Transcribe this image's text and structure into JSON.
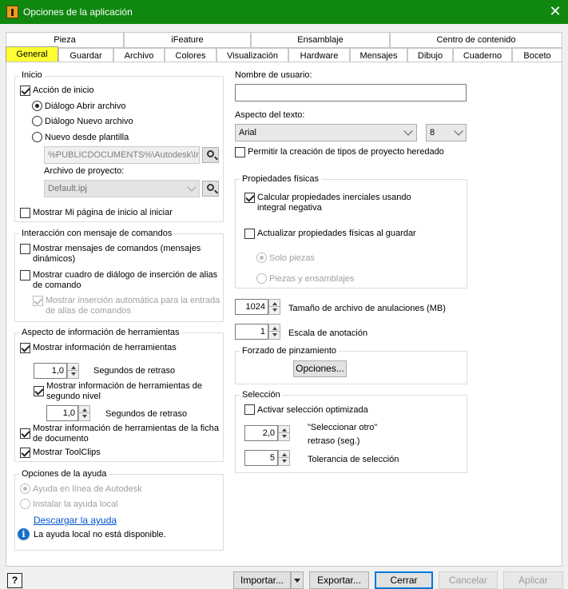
{
  "window": {
    "title": "Opciones de la aplicación"
  },
  "tabs_row1": [
    "Pieza",
    "iFeature",
    "Ensamblaje",
    "Centro de contenido"
  ],
  "tabs_row2": [
    "General",
    "Guardar",
    "Archivo",
    "Colores",
    "Visualización",
    "Hardware",
    "Mensajes",
    "Dibujo",
    "Cuaderno",
    "Boceto"
  ],
  "inicio": {
    "title": "Inicio",
    "accion_inicio": "Acción de inicio",
    "abrir": "Diálogo Abrir archivo",
    "nuevo": "Diálogo Nuevo archivo",
    "plantilla": "Nuevo desde plantilla",
    "plantilla_path": "%PUBLICDOCUMENTS%\\Autodesk\\Inve",
    "proyecto_label": "Archivo de proyecto:",
    "proyecto_value": "Default.ipj",
    "mostrar_pagina": "Mostrar Mi página de inicio al iniciar"
  },
  "interaccion": {
    "title": "Interacción con mensaje de comandos",
    "mensajes": "Mostrar mensajes de comandos (mensajes dinámicos)",
    "alias": "Mostrar cuadro de diálogo de inserción de alias de comando",
    "auto": "Mostrar inserción automática para la entrada de alias de comandos"
  },
  "aspecto_info": {
    "title": "Aspecto de información de herramientas",
    "mostrar_info": "Mostrar información de herramientas",
    "retraso1_value": "1,0",
    "retraso_label": "Segundos de retraso",
    "segundo_nivel": "Mostrar información de herramientas de segundo nivel",
    "retraso2_value": "1,0",
    "ficha": "Mostrar información de herramientas de la ficha de documento",
    "toolclips": "Mostrar ToolClips"
  },
  "ayuda": {
    "title": "Opciones de la ayuda",
    "linea": "Ayuda en línea de Autodesk",
    "local": "Instalar la ayuda local",
    "descargar": "Descargar la ayuda",
    "no_disponible": "La ayuda local no está disponible."
  },
  "derecha": {
    "usuario_label": "Nombre de usuario:",
    "usuario_value": "",
    "aspecto_texto_label": "Aspecto del texto:",
    "fuente": "Arial",
    "tamano": "8",
    "heredado": "Permitir la creación de tipos de proyecto heredado"
  },
  "propiedades": {
    "title": "Propiedades físicas",
    "inerciales": "Calcular propiedades inerciales usando integral negativa",
    "actualizar": "Actualizar propiedades físicas al guardar",
    "solo_piezas": "Solo piezas",
    "piezas_ensamblajes": "Piezas y ensamblajes"
  },
  "anulaciones": {
    "value": "1024",
    "label": "Tamaño de archivo de anulaciones (MB)"
  },
  "escala": {
    "value": "1",
    "label": "Escala de anotación"
  },
  "pinzamiento": {
    "title": "Forzado de pinzamiento",
    "opciones": "Opciones..."
  },
  "seleccion": {
    "title": "Selección",
    "optimizada": "Activar selección optimizada",
    "retraso_value": "2,0",
    "retraso_label_1": "\"Seleccionar otro\"",
    "retraso_label_2": "retraso (seg.)",
    "tolerancia_value": "5",
    "tolerancia_label": "Tolerancia de selección"
  },
  "footer": {
    "help": "?",
    "importar": "Importar...",
    "exportar": "Exportar...",
    "cerrar": "Cerrar",
    "cancelar": "Cancelar",
    "aplicar": "Aplicar"
  },
  "colors": {
    "titlebar": "#108810",
    "active_tab": "#ffff33",
    "focus": "#0078d7"
  }
}
